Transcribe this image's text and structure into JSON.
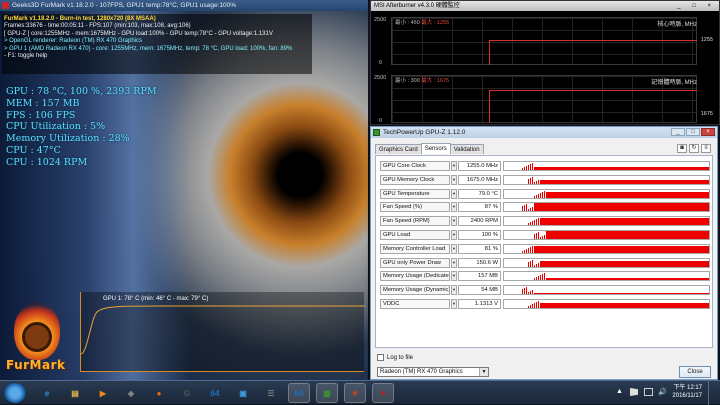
{
  "furmark": {
    "title": "Geeks3D FurMark v1.18.2.0 - 107FPS, GPU1 temp:78°C, GPU1 usage:100%",
    "lines": [
      {
        "text": "FurMark v1.18.2.0 - Burn-in test, 1280x720 (8X MSAA)",
        "cls": "yl"
      },
      {
        "text": "Frames:33676 - time:00:05:11 - FPS:107 (min:103, max:108, avg:106)",
        "cls": "wh"
      },
      {
        "text": "[ GPU-Z ] core:1255MHz - mem:1675MHz - GPU load:100% - GPU temp:78°C - GPU voltage:1.131V",
        "cls": "wh"
      },
      {
        "text": "> OpenGL renderer: Radeon (TM) RX 470 Graphics",
        "cls": "gr"
      },
      {
        "text": "> GPU 1 (AMD Radeon RX 470) - core: 1255MHz, mem: 1675MHz, temp: 78 °C, GPU load: 100%, fan: 89%",
        "cls": "gr"
      },
      {
        "text": "- F1: toggle help",
        "cls": "wh"
      }
    ],
    "stats": [
      "GPU : 78 °C, 100 %, 2393 RPM",
      "MEM : 157 MB",
      "FPS : 106 FPS",
      "CPU Utilization : 5%",
      "Memory Utilization : 28%",
      "CPU : 47°C",
      "CPU : 1024 RPM"
    ],
    "graph_label": "GPU 1: 78° C (min: 46° C - max: 79° C)",
    "logo_text": "FurMark",
    "temp_current": 78,
    "temp_min": 46,
    "temp_max": 79
  },
  "afterburner": {
    "title": "MSI Afterburner v4.3.0 硬體監控",
    "controls": "_ □ ×",
    "panels": [
      {
        "name": "核心時脈, MHz",
        "ymax": "2500",
        "ymin": "0",
        "min_label": "最小 : 460",
        "max_label": "最大 : 1255",
        "current": "1255",
        "level": 0.502
      },
      {
        "name": "記憶體時脈, MHz",
        "ymax": "2500",
        "ymin": "0",
        "min_label": "最小 : 300",
        "max_label": "最大 : 1675",
        "current": "1675",
        "level": 0.67
      }
    ]
  },
  "gpuz": {
    "title": "TechPowerUp GPU-Z 1.12.0",
    "tabs": [
      "Graphics Card",
      "Sensors",
      "Validation"
    ],
    "active_tab": "Sensors",
    "sensors": [
      {
        "name": "GPU Core Clock",
        "value": "1255.0 MHz",
        "level": 0.35
      },
      {
        "name": "GPU Memory Clock",
        "value": "1675.0 MHz",
        "level": 0.45
      },
      {
        "name": "GPU Temperature",
        "value": "79.0 °C",
        "level": 0.62
      },
      {
        "name": "Fan Speed (%)",
        "value": "87 %",
        "level": 0.85
      },
      {
        "name": "Fan Speed (RPM)",
        "value": "2400 RPM",
        "level": 0.8
      },
      {
        "name": "GPU Load",
        "value": "100 %",
        "level": 1.0
      },
      {
        "name": "Memory Controller Load",
        "value": "81 %",
        "level": 0.8
      },
      {
        "name": "GPU only Power Draw",
        "value": "150.6 W",
        "level": 0.7
      },
      {
        "name": "Memory Usage (Dedicated)",
        "value": "157 MB",
        "level": 0.2
      },
      {
        "name": "Memory Usage (Dynamic)",
        "value": "54 MB",
        "level": 0.12
      },
      {
        "name": "VDDC",
        "value": "1.1313 V",
        "level": 0.55
      }
    ],
    "log_label": "Log to file",
    "device": "Radeon (TM) RX 470 Graphics",
    "close_label": "Close"
  },
  "taskbar": {
    "time": "下午 12:17",
    "date": "2016/11/17",
    "apps": [
      {
        "name": "ie-icon",
        "glyph": "e",
        "color": "#2d8fe0"
      },
      {
        "name": "explorer-icon",
        "glyph": "▤",
        "color": "#e8b84a"
      },
      {
        "name": "media-player-icon",
        "glyph": "▶",
        "color": "#f08c1d"
      },
      {
        "name": "cpuz-icon",
        "glyph": "◈",
        "color": "#888"
      },
      {
        "name": "firefox-icon",
        "glyph": "●",
        "color": "#e86a1a"
      },
      {
        "name": "gpu-shark-icon",
        "glyph": "G",
        "color": "#555"
      },
      {
        "name": "aida64-icon",
        "glyph": "64",
        "color": "#1d6fb8"
      },
      {
        "name": "tool-icon",
        "glyph": "▣",
        "color": "#3a9ad9"
      },
      {
        "name": "mobile-icon",
        "glyph": "☰",
        "color": "#777"
      },
      {
        "name": "aida64b-icon",
        "glyph": "64",
        "color": "#1d6fb8"
      },
      {
        "name": "gpuz-icon",
        "glyph": "▩",
        "color": "#3e8f2e"
      },
      {
        "name": "furmark-icon",
        "glyph": "☀",
        "color": "#d1401f"
      },
      {
        "name": "msi-icon",
        "glyph": "✦",
        "color": "#b3261e"
      }
    ]
  }
}
